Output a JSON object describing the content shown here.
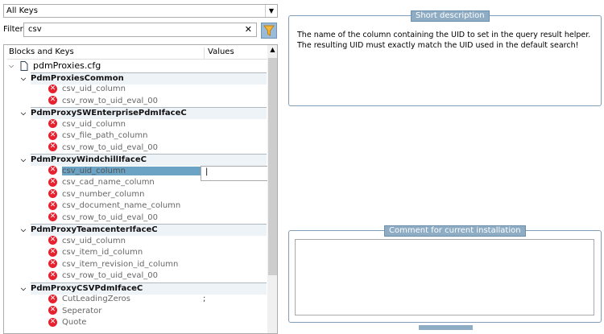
{
  "combo": {
    "value": "All Keys"
  },
  "filter": {
    "label": "Filter",
    "value": "csv"
  },
  "tree": {
    "col_keys": "Blocks and Keys",
    "col_values": "Values",
    "root": "pdmProxies.cfg",
    "blocks": [
      {
        "name": "PdmProxiesCommon",
        "keys": [
          {
            "k": "csv_uid_column"
          },
          {
            "k": "csv_row_to_uid_eval_00"
          }
        ]
      },
      {
        "name": "PdmProxySWEnterprisePdmIfaceC",
        "keys": [
          {
            "k": "csv_uid_column"
          },
          {
            "k": "csv_file_path_column"
          },
          {
            "k": "csv_row_to_uid_eval_00"
          }
        ]
      },
      {
        "name": "PdmProxyWindchillIfaceC",
        "keys": [
          {
            "k": "csv_uid_column",
            "selected": true
          },
          {
            "k": "csv_cad_name_column"
          },
          {
            "k": "csv_number_column"
          },
          {
            "k": "csv_document_name_column"
          },
          {
            "k": "csv_row_to_uid_eval_00"
          }
        ]
      },
      {
        "name": "PdmProxyTeamcenterIfaceC",
        "keys": [
          {
            "k": "csv_uid_column"
          },
          {
            "k": "csv_item_id_column"
          },
          {
            "k": "csv_item_revision_id_column"
          },
          {
            "k": "csv_row_to_uid_eval_00"
          }
        ]
      },
      {
        "name": "PdmProxyCSVPdmIfaceC",
        "keys": [
          {
            "k": "CutLeadingZeros",
            "v": ";"
          },
          {
            "k": "Seperator"
          },
          {
            "k": "Quote"
          }
        ]
      }
    ]
  },
  "desc": {
    "title": "Short description",
    "text": "The name of the column containing the UID to set in the query result helper. The resulting UID must exactly match the UID used in the default search!"
  },
  "comment": {
    "title": "Comment for current installation",
    "value": ""
  }
}
